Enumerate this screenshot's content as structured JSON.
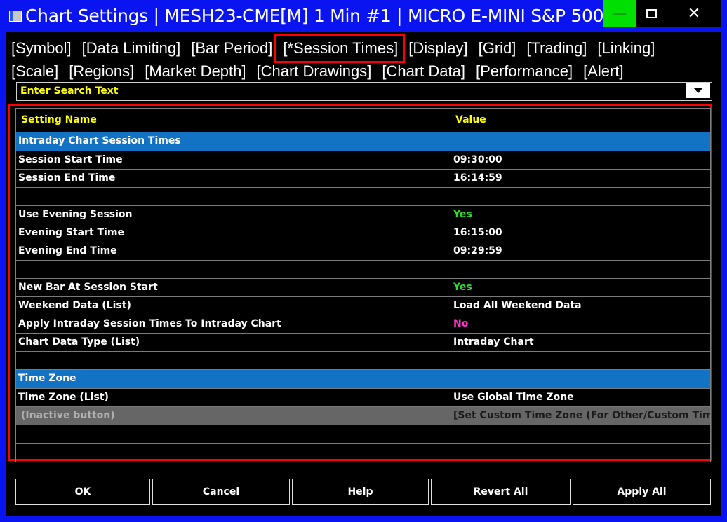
{
  "window": {
    "title": "Chart Settings | MESH23-CME[M]  1 Min   #1 | MICRO E-MINI S&P 500...",
    "minimize_label": "—",
    "close_label": "✕"
  },
  "tabs_row1": [
    "[Symbol]",
    "[Data Limiting]",
    "[Bar Period]",
    "[*Session Times]",
    "[Display]",
    "[Grid]",
    "[Trading]",
    "[Linking]"
  ],
  "tabs_row2": [
    "[Scale]",
    "[Regions]",
    "[Market Depth]",
    "[Chart Drawings]",
    "[Chart Data]",
    "[Performance]",
    "[Alert]"
  ],
  "search": {
    "placeholder": "Enter Search Text"
  },
  "grid": {
    "header_name": "Setting Name",
    "header_value": "Value",
    "section1": "Intraday Chart Session Times",
    "rows1": [
      {
        "name": "Session Start Time",
        "value": "09:30:00"
      },
      {
        "name": "Session End Time",
        "value": "16:14:59"
      },
      {
        "name": "",
        "value": ""
      },
      {
        "name": "Use Evening Session",
        "value": "Yes"
      },
      {
        "name": "Evening Start Time",
        "value": "16:15:00"
      },
      {
        "name": "Evening End Time",
        "value": "09:29:59"
      },
      {
        "name": "",
        "value": ""
      },
      {
        "name": "New Bar At Session Start",
        "value": "Yes"
      },
      {
        "name": "Weekend Data (List)",
        "value": "Load All Weekend Data"
      },
      {
        "name": "Apply Intraday Session Times To Intraday Chart",
        "value": "No"
      },
      {
        "name": "Chart Data Type (List)",
        "value": "Intraday Chart"
      },
      {
        "name": "",
        "value": ""
      }
    ],
    "section2": "Time Zone",
    "rows2": [
      {
        "name": "Time Zone (List)",
        "value": "Use Global Time Zone"
      },
      {
        "name": "(Inactive button)",
        "value": "[Set Custom Time Zone (For Other/Custom Time Zone)]"
      }
    ]
  },
  "buttons": {
    "ok": "OK",
    "cancel": "Cancel",
    "help": "Help",
    "revert_all": "Revert All",
    "apply_all": "Apply All"
  },
  "colors": {
    "window_bg": "#0a14f0",
    "section_bg": "#1272c4",
    "yes": "#2be02b",
    "no": "#ff33cc",
    "header_text": "#ffff00"
  }
}
